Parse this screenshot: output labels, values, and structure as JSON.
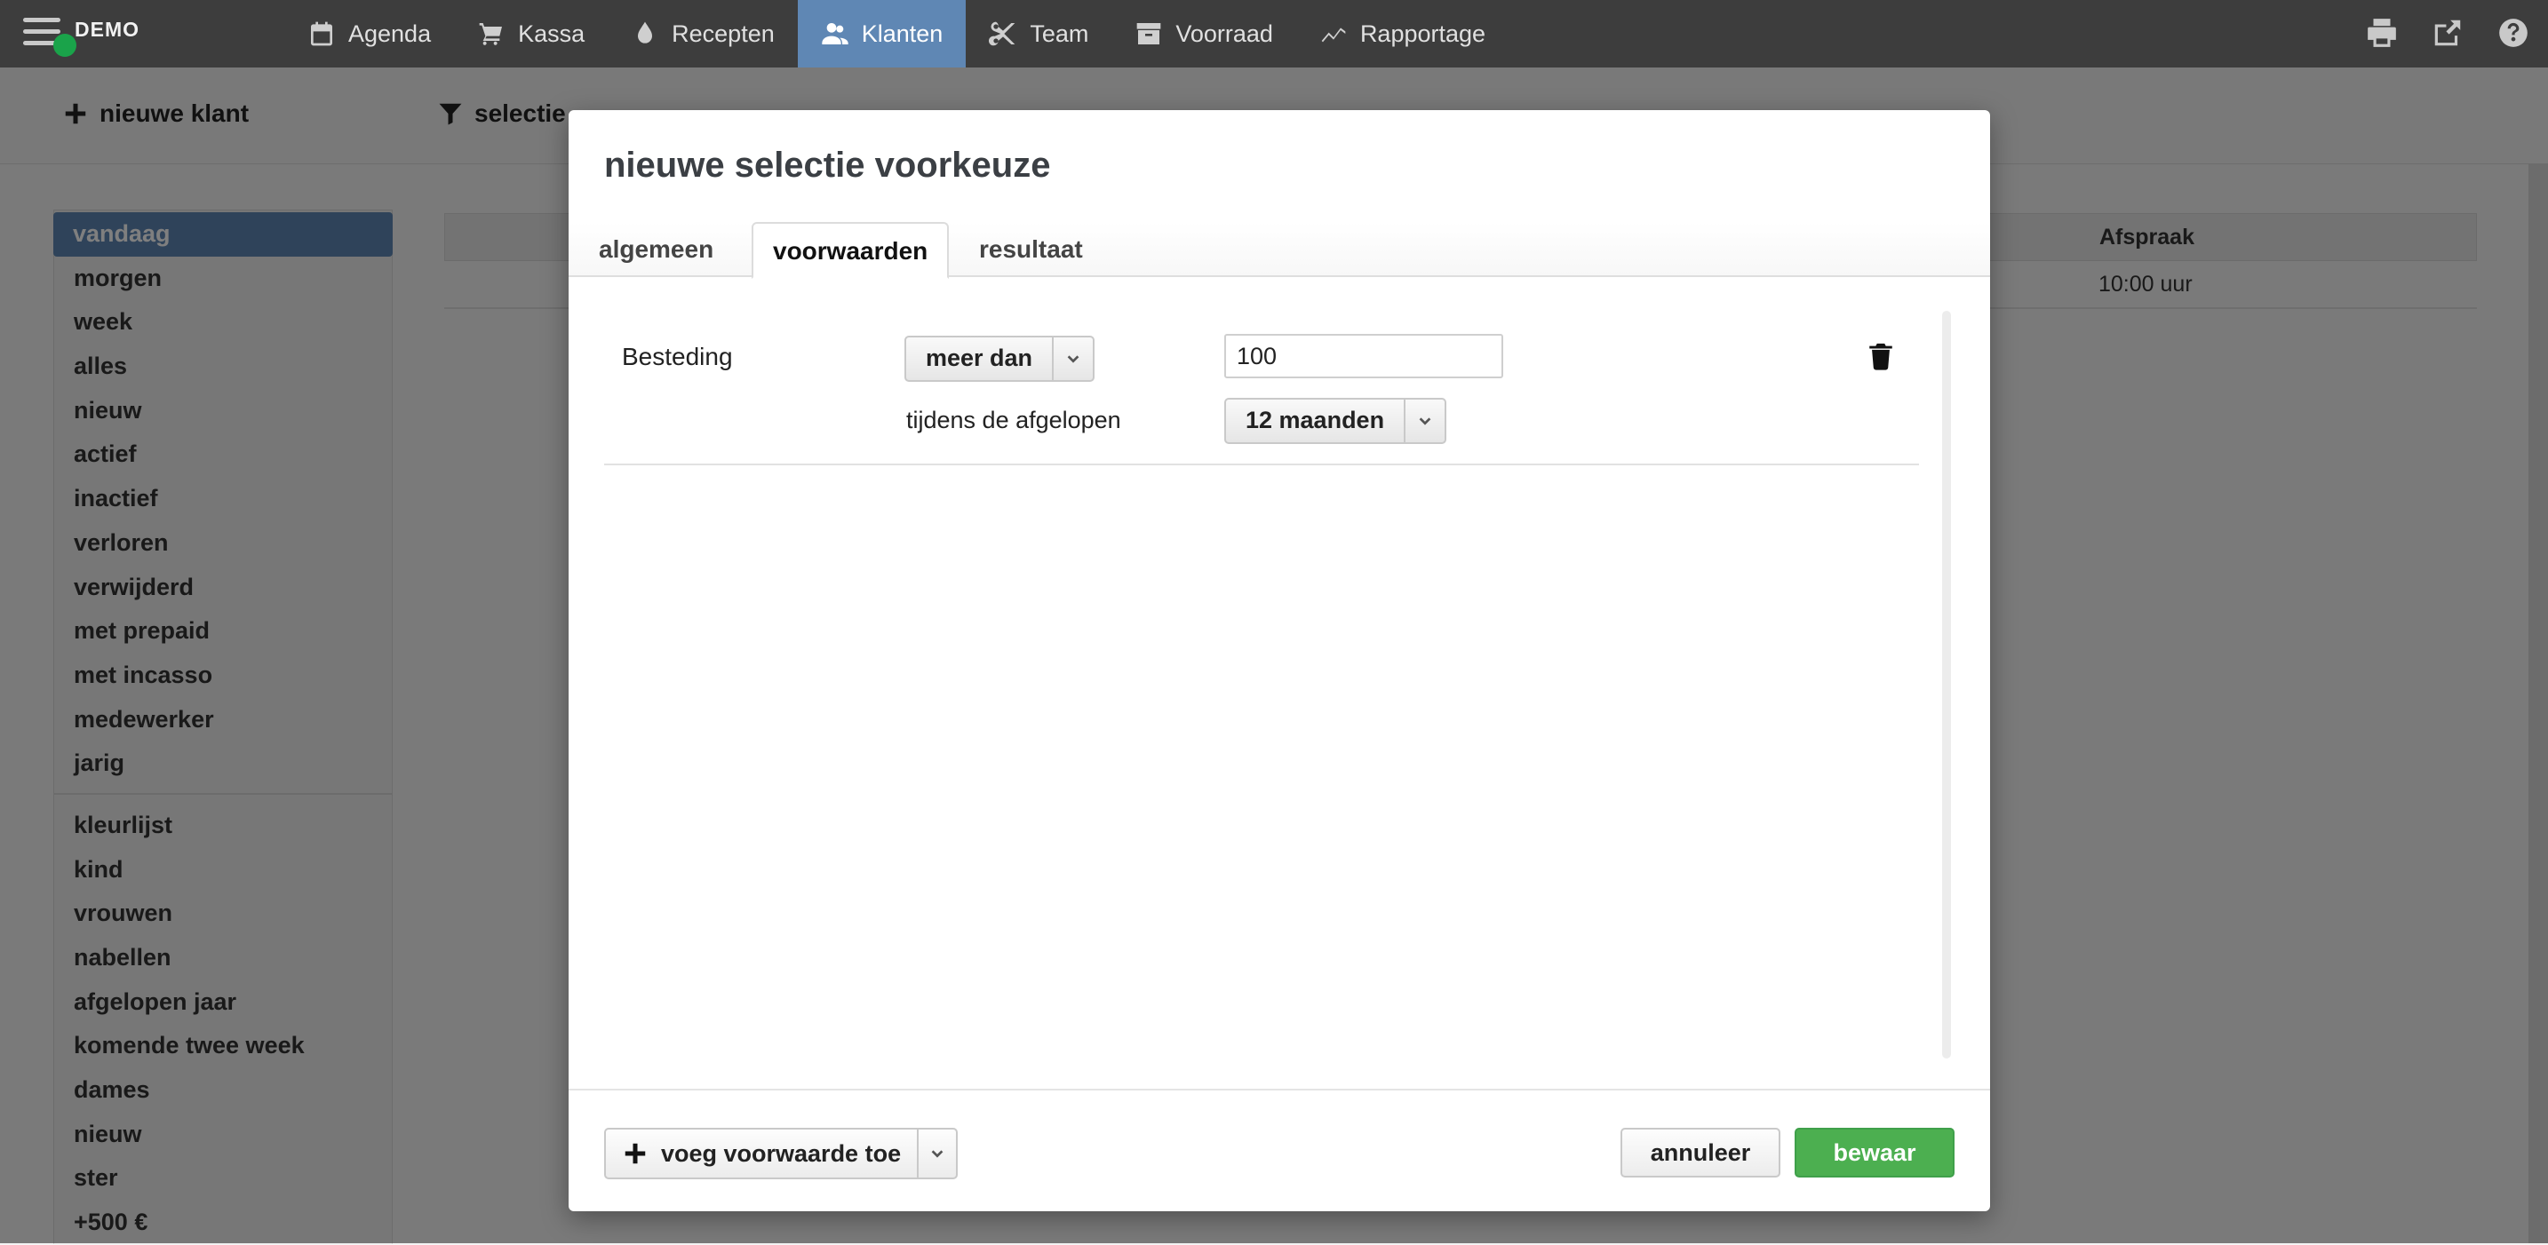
{
  "app": {
    "brand": "DEMO"
  },
  "nav": {
    "items": [
      {
        "label": "Agenda",
        "icon": "calendar-icon"
      },
      {
        "label": "Kassa",
        "icon": "cart-icon"
      },
      {
        "label": "Recepten",
        "icon": "drop-icon"
      },
      {
        "label": "Klanten",
        "icon": "users-icon",
        "active": true
      },
      {
        "label": "Team",
        "icon": "scissors-icon"
      },
      {
        "label": "Voorraad",
        "icon": "box-icon"
      },
      {
        "label": "Rapportage",
        "icon": "chart-line-icon"
      }
    ],
    "tools": [
      "print-icon",
      "share-icon",
      "help-icon"
    ]
  },
  "toolbar": {
    "new_customer": "nieuwe klant",
    "selection": "selectie"
  },
  "sidebar": {
    "group1": [
      "vandaag",
      "morgen",
      "week",
      "alles",
      "nieuw",
      "actief",
      "inactief",
      "verloren",
      "verwijderd",
      "met prepaid",
      "met incasso",
      "medewerker",
      "jarig"
    ],
    "group2": [
      "kleurlijst",
      "kind",
      "vrouwen",
      "nabellen",
      "afgelopen jaar",
      "komende twee week",
      "dames",
      "nieuw",
      "ster",
      "+500 €"
    ]
  },
  "table": {
    "header_appointment": "Afspraak",
    "row_appointment": "10:00 uur"
  },
  "modal": {
    "title": "nieuwe selectie voorkeuze",
    "tabs": [
      "algemeen",
      "voorwaarden",
      "resultaat"
    ],
    "condition": {
      "label": "Besteding",
      "operator": "meer dan",
      "value": "100",
      "period_label": "tijdens de afgelopen",
      "period": "12 maanden"
    },
    "add_condition": "voeg voorwaarde toe",
    "cancel": "annuleer",
    "save": "bewaar"
  },
  "colors": {
    "nav_bg": "#3d3d3d",
    "accent": "#5f87b4",
    "save_green": "#4caf50",
    "status_dot": "#1aa34a"
  }
}
